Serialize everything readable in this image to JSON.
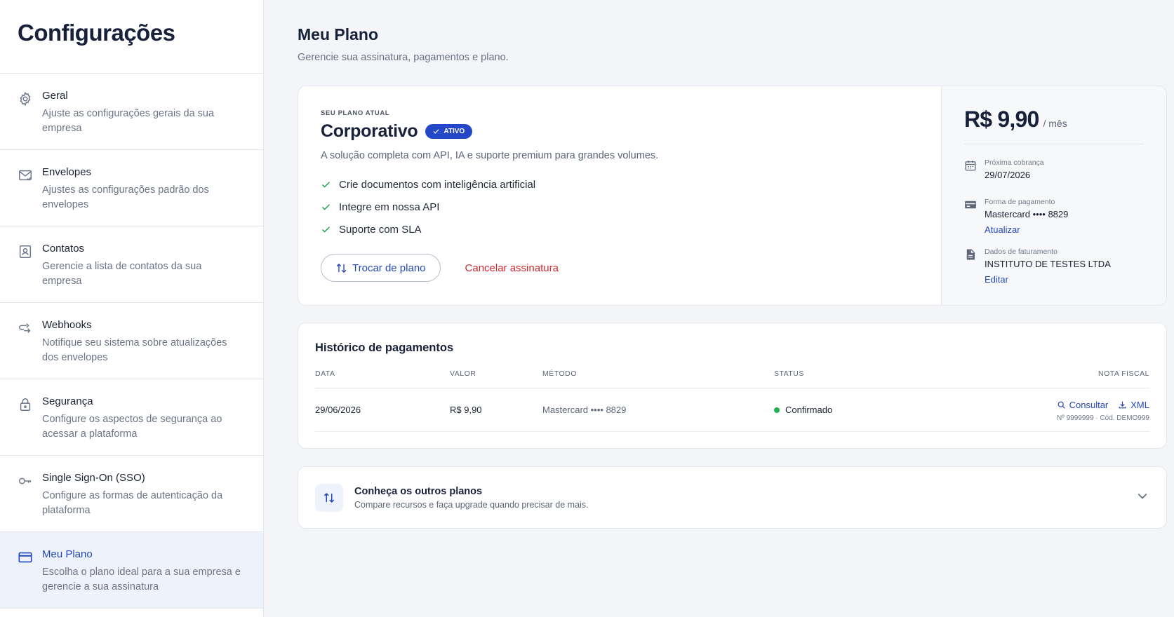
{
  "sidebar": {
    "title": "Configurações",
    "items": [
      {
        "label": "Geral",
        "desc": "Ajuste as configurações gerais da sua empresa",
        "icon": "gear-icon"
      },
      {
        "label": "Envelopes",
        "desc": "Ajustes as configurações padrão dos envelopes",
        "icon": "envelope-icon"
      },
      {
        "label": "Contatos",
        "desc": "Gerencie a lista de contatos da sua empresa",
        "icon": "contacts-icon"
      },
      {
        "label": "Webhooks",
        "desc": "Notifique seu sistema sobre atualizações dos envelopes",
        "icon": "webhook-icon"
      },
      {
        "label": "Segurança",
        "desc": "Configure os aspectos de segurança ao acessar a plataforma",
        "icon": "lock-icon"
      },
      {
        "label": "Single Sign-On (SSO)",
        "desc": "Configure as formas de autenticação da plataforma",
        "icon": "key-icon"
      },
      {
        "label": "Meu Plano",
        "desc": "Escolha o plano ideal para a sua empresa e gerencie a sua assinatura",
        "icon": "credit-card-icon",
        "active": true
      }
    ]
  },
  "page": {
    "title": "Meu Plano",
    "subtitle": "Gerencie sua assinatura, pagamentos e plano."
  },
  "plan": {
    "eyebrow": "SEU PLANO ATUAL",
    "name": "Corporativo",
    "badge": "ATIVO",
    "description": "A solução completa com API, IA e suporte premium para grandes volumes.",
    "features": [
      "Crie documentos com inteligência artificial",
      "Integre em nossa API",
      "Suporte com SLA"
    ],
    "change_button": "Trocar de plano",
    "cancel_button": "Cancelar assinatura"
  },
  "billing": {
    "price": "R$ 9,90",
    "period": "/ mês",
    "next_charge_label": "Próxima cobrança",
    "next_charge_value": "29/07/2026",
    "payment_label": "Forma de pagamento",
    "payment_value": "Mastercard •••• 8829",
    "payment_link": "Atualizar",
    "invoice_label": "Dados de faturamento",
    "invoice_value": "INSTITUTO DE TESTES LTDA",
    "invoice_link": "Editar"
  },
  "history": {
    "title": "Histórico de pagamentos",
    "columns": {
      "date": "DATA",
      "value": "VALOR",
      "method": "MÉTODO",
      "status": "STATUS",
      "nf": "NOTA FISCAL"
    },
    "rows": [
      {
        "date": "29/06/2026",
        "value": "R$ 9,90",
        "method": "Mastercard •••• 8829",
        "status": "Confirmado",
        "consult": "Consultar",
        "xml": "XML",
        "nf_meta": "Nº 9999999 · Cód. DEMO999"
      }
    ]
  },
  "other_plans": {
    "title": "Conheça os outros planos",
    "desc": "Compare recursos e faça upgrade quando precisar de mais."
  },
  "colors": {
    "accent": "#2447b8",
    "success": "#1bb24f",
    "danger": "#d3282f"
  }
}
